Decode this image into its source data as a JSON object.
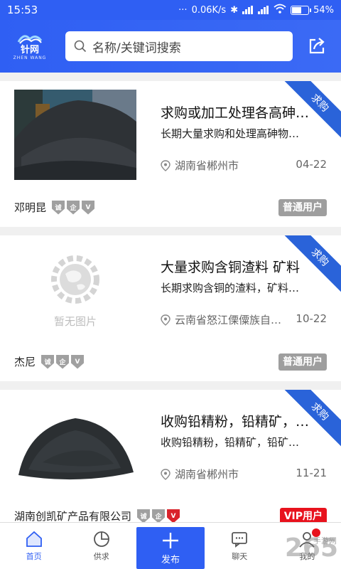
{
  "status": {
    "time": "15:53",
    "speed": "0.06K/s",
    "battery": "54%",
    "battery_level": 0.54
  },
  "header": {
    "logo_name": "针网",
    "logo_sub": "ZHEN WANG",
    "search_placeholder": "名称/关键词搜索"
  },
  "cards": [
    {
      "title": "求购或加工处理各高砷…",
      "desc": "长期大量求购和处理高砷物…",
      "location": "湖南省郴州市",
      "date": "04-22",
      "poster": "邓明昆",
      "user_type": "普通用户",
      "ribbon": "求购",
      "image": "coal-pile"
    },
    {
      "title": "大量求购含铜渣料 矿料",
      "desc": "长期求购含铜的渣料，矿料…",
      "location": "云南省怒江傈僳族自…",
      "date": "10-22",
      "poster": "杰尼",
      "user_type": "普通用户",
      "ribbon": "求购",
      "image": "placeholder",
      "no_image_text": "暂无图片"
    },
    {
      "title": "收购铅精粉，铅精矿，…",
      "desc": "收购铅精粉，铅精矿，铅矿…",
      "location": "湖南省郴州市",
      "date": "11-21",
      "poster": "湖南创凯矿产品有限公司",
      "user_type": "VIP用户",
      "ribbon": "求购",
      "image": "powder"
    }
  ],
  "badges": {
    "cheng": "诚",
    "qi": "企",
    "v": "V"
  },
  "nav": {
    "home": "首页",
    "supply": "供求",
    "publish": "发布",
    "chat": "聊天",
    "mine": "我的"
  },
  "watermark": {
    "main": "265",
    "sub": "手游网"
  },
  "colors": {
    "brand": "#2f5ff3",
    "ribbon": "#2a63d9",
    "vip": "#e8121d",
    "normal_user": "#9e9e9e"
  }
}
